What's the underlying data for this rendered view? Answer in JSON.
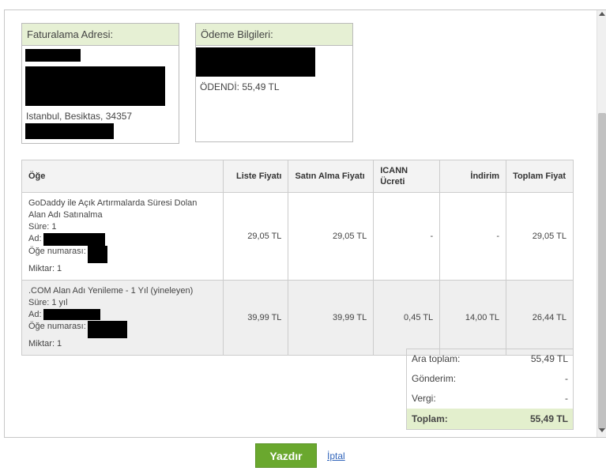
{
  "billing": {
    "title": "Faturalama Adresi:",
    "city_line": "Istanbul, Besiktas, 34357"
  },
  "payment": {
    "title": "Ödeme Bilgileri:",
    "status": "ÖDENDİ: 55,49 TL"
  },
  "table": {
    "headers": {
      "item": "Öğe",
      "list_price": "Liste Fiyatı",
      "purchase_price": "Satın Alma Fiyatı",
      "icann_fee": "ICANN Ücreti",
      "discount": "İndirim",
      "total_price": "Toplam Fiyat"
    },
    "rows": [
      {
        "desc_title": "GoDaddy ile Açık Artırmalarda Süresi Dolan Alan Adı Satınalma",
        "duration": "Süre: 1",
        "name_label": "Ad:",
        "item_no_label": "Öğe numarası:",
        "quantity": "Miktar: 1",
        "list_price": "29,05 TL",
        "purchase_price": "29,05 TL",
        "icann_fee": "-",
        "discount": "-",
        "total": "29,05 TL"
      },
      {
        "desc_title": ".COM Alan Adı Yenileme - 1 Yıl (yineleyen)",
        "duration": "Süre: 1 yıl",
        "name_label": "Ad:",
        "item_no_label": "Öğe numarası:",
        "quantity": "Miktar: 1",
        "list_price": "39,99 TL",
        "purchase_price": "39,99 TL",
        "icann_fee": "0,45 TL",
        "discount": "14,00 TL",
        "total": "26,44 TL"
      }
    ]
  },
  "totals": {
    "subtotal_label": "Ara toplam:",
    "subtotal_value": "55,49 TL",
    "shipping_label": "Gönderim:",
    "shipping_value": "-",
    "tax_label": "Vergi:",
    "tax_value": "-",
    "total_label": "Toplam:",
    "total_value": "55,49 TL"
  },
  "actions": {
    "print": "Yazdır",
    "cancel": "İptal"
  }
}
